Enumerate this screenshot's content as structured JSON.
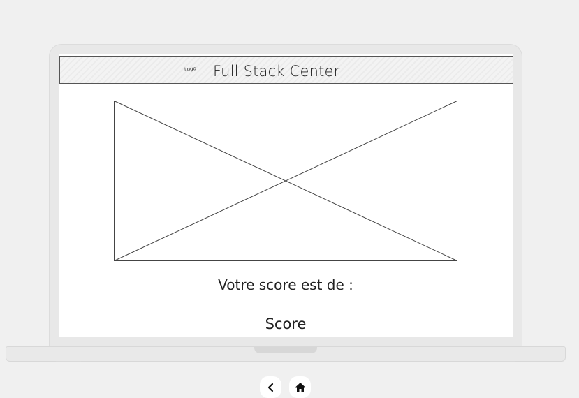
{
  "header": {
    "logo_label": "Logo",
    "site_title": "Full Stack Center"
  },
  "main": {
    "image_placeholder": "image-placeholder-icon",
    "score_label": "Votre score est de :",
    "score_value": "Score"
  },
  "nav": {
    "back_icon": "chevron-left-icon",
    "home_icon": "home-icon"
  },
  "colors": {
    "background": "#f0f0f0",
    "device_frame": "#e8e8e8",
    "screen": "#ffffff",
    "ink": "#222222"
  }
}
